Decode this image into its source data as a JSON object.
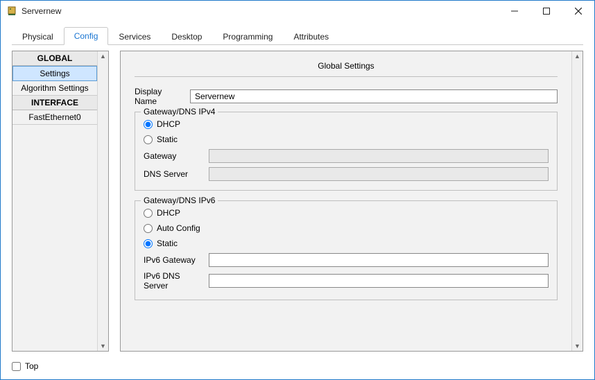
{
  "window": {
    "title": "Servernew"
  },
  "tabs": [
    "Physical",
    "Config",
    "Services",
    "Desktop",
    "Programming",
    "Attributes"
  ],
  "sidebar": {
    "headers": {
      "global": "GLOBAL",
      "interface": "INTERFACE"
    },
    "global_items": [
      "Settings",
      "Algorithm Settings"
    ],
    "interface_items": [
      "FastEthernet0"
    ]
  },
  "panel": {
    "title": "Global Settings",
    "display_name_label": "Display Name",
    "display_name_value": "Servernew",
    "ipv4": {
      "legend": "Gateway/DNS IPv4",
      "dhcp": "DHCP",
      "static": "Static",
      "gateway_label": "Gateway",
      "gateway_value": "",
      "dns_label": "DNS Server",
      "dns_value": ""
    },
    "ipv6": {
      "legend": "Gateway/DNS IPv6",
      "dhcp": "DHCP",
      "auto": "Auto Config",
      "static": "Static",
      "gateway_label": "IPv6 Gateway",
      "gateway_value": "",
      "dns_label": "IPv6 DNS Server",
      "dns_value": ""
    }
  },
  "footer": {
    "top_label": "Top"
  }
}
